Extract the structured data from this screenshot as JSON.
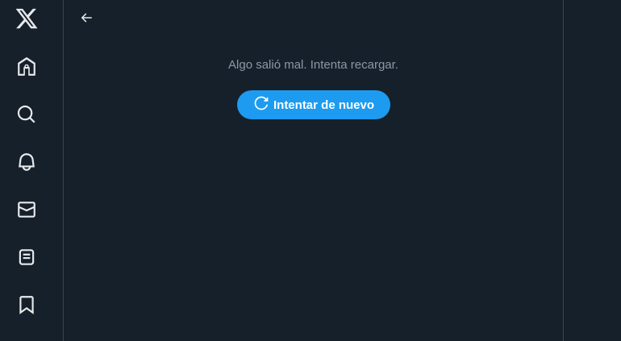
{
  "sidebar": {
    "items": [
      {
        "icon": "x-logo-icon"
      },
      {
        "icon": "home-icon"
      },
      {
        "icon": "search-icon"
      },
      {
        "icon": "bell-icon"
      },
      {
        "icon": "mail-icon"
      },
      {
        "icon": "lists-icon"
      },
      {
        "icon": "bookmark-icon"
      }
    ]
  },
  "main": {
    "back_icon": "arrow-left-icon",
    "error_message": "Algo salió mal. Intenta recargar.",
    "retry_label": "Intentar de nuevo",
    "retry_icon": "refresh-icon"
  },
  "colors": {
    "background": "#15202b",
    "border": "#38444d",
    "accent": "#1d9bf0",
    "muted_text": "#8b98a5",
    "icon": "#e7e9ea"
  }
}
